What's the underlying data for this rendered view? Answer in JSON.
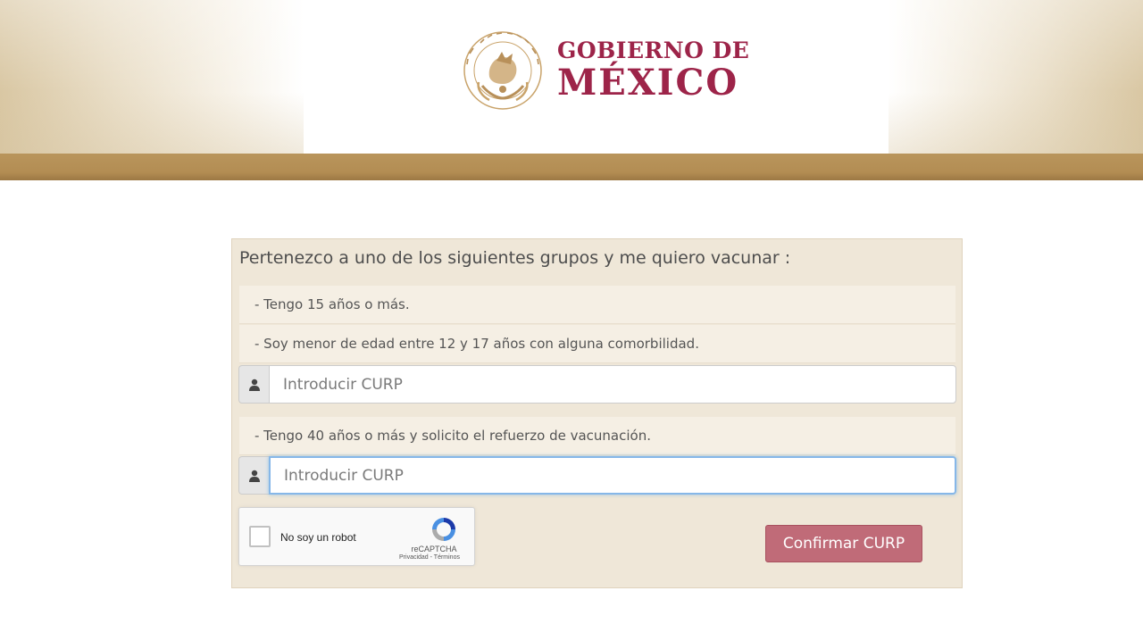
{
  "header": {
    "logo_line1": "GOBIERNO DE",
    "logo_line2": "MÉXICO",
    "seal_icon": "escudo-nacional-icon"
  },
  "colors": {
    "brand_red": "#9d2449",
    "gold": "#b38d53",
    "panel_bg": "#efe7d8",
    "button_bg": "#c06b78"
  },
  "form": {
    "title": "Pertenezco a uno de los siguientes grupos y me quiero vacunar :",
    "groups": [
      {
        "label": "- Tengo 15 años o más."
      },
      {
        "label": "- Soy menor de edad entre 12 y 17 años con alguna comorbilidad."
      },
      {
        "label": "- Tengo 40 años o más y solicito el refuerzo de vacunación."
      }
    ],
    "curp_inputs": [
      {
        "placeholder": "Introducir CURP",
        "value": ""
      },
      {
        "placeholder": "Introducir CURP",
        "value": ""
      }
    ],
    "confirm_label": "Confirmar CURP"
  },
  "recaptcha": {
    "label": "No soy un robot",
    "brand": "reCAPTCHA",
    "links": "Privacidad - Términos"
  }
}
